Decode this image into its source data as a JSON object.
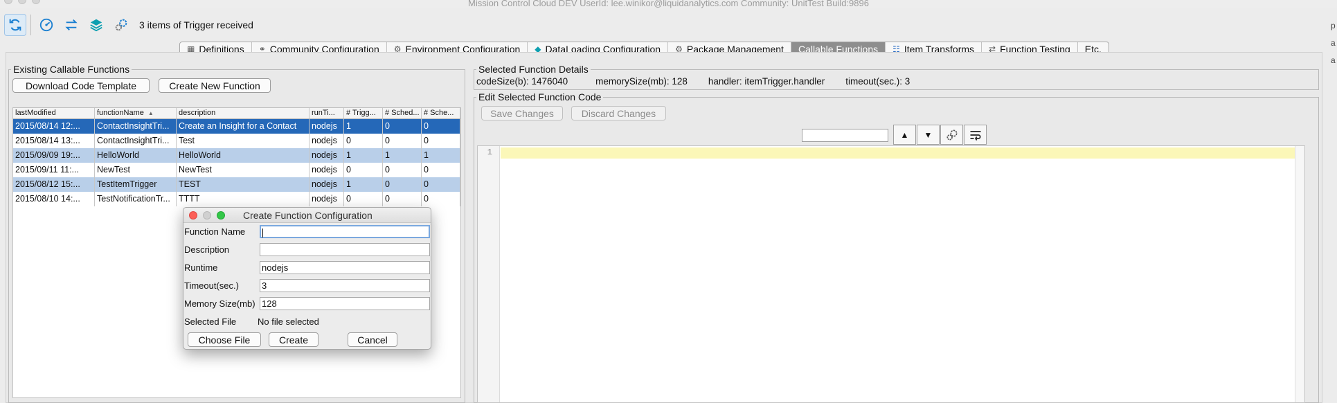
{
  "window": {
    "title": "Mission Control Cloud DEV   UserId: lee.winikor@liquidanalytics.com    Community: UnitTest    Build:9896"
  },
  "toolbar": {
    "status": "3 items of Trigger received"
  },
  "tabs": [
    {
      "label": "Definitions",
      "icon": "grid-icon"
    },
    {
      "label": "Community Configuration",
      "icon": "network-icon"
    },
    {
      "label": "Environment Configuration",
      "icon": "cog-cluster-icon"
    },
    {
      "label": "DataLoading Configuration",
      "icon": "cube-icon"
    },
    {
      "label": "Package Management",
      "icon": "gear-icon"
    },
    {
      "label": "Callable Functions",
      "icon": "",
      "selected": true
    },
    {
      "label": "Item Transforms",
      "icon": "list-grid-icon"
    },
    {
      "label": "Function Testing",
      "icon": "arrows-icon"
    },
    {
      "label": "Etc.",
      "icon": ""
    }
  ],
  "left_panel": {
    "title": "Existing Callable Functions",
    "download_label": "Download Code Template",
    "create_label": "Create New Function",
    "columns": [
      "lastModified",
      "functionName",
      "description",
      "runTi...",
      "# Trigg...",
      "# Sched...",
      "# Sche..."
    ],
    "rows": [
      [
        "2015/08/14 12:...",
        "ContactInsightTri...",
        "Create an Insight for a Contact",
        "nodejs",
        "1",
        "0",
        "0"
      ],
      [
        "2015/08/14 13:...",
        "ContactInsightTri...",
        "Test",
        "nodejs",
        "0",
        "0",
        "0"
      ],
      [
        "2015/09/09 19:...",
        "HelloWorld",
        "HelloWorld",
        "nodejs",
        "1",
        "1",
        "1"
      ],
      [
        "2015/09/11 11:...",
        "NewTest",
        "NewTest",
        "nodejs",
        "0",
        "0",
        "0"
      ],
      [
        "2015/08/12 15:...",
        "TestItemTrigger",
        "TEST",
        "nodejs",
        "1",
        "0",
        "0"
      ],
      [
        "2015/08/10 14:...",
        "TestNotificationTr...",
        "TTTT",
        "nodejs",
        "0",
        "0",
        "0"
      ]
    ]
  },
  "details": {
    "title": "Selected Function Details",
    "code_size": "codeSize(b): 1476040",
    "memory_size": "memorySize(mb): 128",
    "handler": "handler: itemTrigger.handler",
    "timeout": "timeout(sec.): 3"
  },
  "editor": {
    "title": "Edit Selected Function Code",
    "save_label": "Save Changes",
    "discard_label": "Discard Changes",
    "line_number": "1",
    "up_glyph": "▲",
    "down_glyph": "▼"
  },
  "dialog": {
    "title": "Create Function Configuration",
    "name_label": "Function Name",
    "name_value": "",
    "description_label": "Description",
    "description_value": "",
    "runtime_label": "Runtime",
    "runtime_value": "nodejs",
    "timeout_label": "Timeout(sec.)",
    "timeout_value": "3",
    "memory_label": "Memory Size(mb)",
    "memory_value": "128",
    "file_label": "Selected File",
    "file_value": "No file selected",
    "choose_label": "Choose File",
    "create_label": "Create",
    "cancel_label": "Cancel"
  },
  "right_strip": [
    "p",
    "a",
    "a"
  ]
}
